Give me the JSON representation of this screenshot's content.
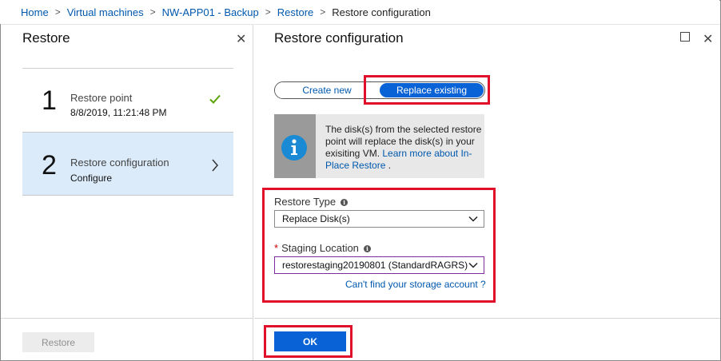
{
  "breadcrumb": {
    "items": [
      "Home",
      "Virtual machines",
      "NW-APP01 - Backup",
      "Restore",
      "Restore configuration"
    ],
    "separator": ">"
  },
  "left_blade": {
    "title": "Restore",
    "close_glyph": "✕",
    "steps": [
      {
        "number": "1",
        "title": "Restore point",
        "subtitle": "8/8/2019, 11:21:48 PM",
        "status_icon": "check-icon"
      },
      {
        "number": "2",
        "title": "Restore configuration",
        "subtitle": "Configure",
        "status_icon": "chevron-right-icon"
      }
    ],
    "restore_button_label": "Restore"
  },
  "right_blade": {
    "title": "Restore configuration",
    "close_glyph": "✕",
    "toggle": {
      "option_new": "Create new",
      "option_replace": "Replace existing",
      "selected": "Replace existing"
    },
    "info": {
      "text": "The disk(s) from the selected restore point will replace the disk(s) in your exisiting VM.",
      "link": "Learn more about In-Place Restore",
      "suffix": "."
    },
    "restore_type": {
      "label": "Restore Type",
      "value": "Replace Disk(s)"
    },
    "staging_location": {
      "required_mark": "*",
      "label": "Staging Location",
      "value": "restorestaging20190801 (StandardRAGRS)"
    },
    "storage_link": "Can't find your storage account ?",
    "ok_label": "OK"
  },
  "colors": {
    "accent": "#0a63d6",
    "link": "#0058ad",
    "highlight": "#e0102a",
    "selected_step_bg": "#dbebfa",
    "check": "#57a300"
  }
}
